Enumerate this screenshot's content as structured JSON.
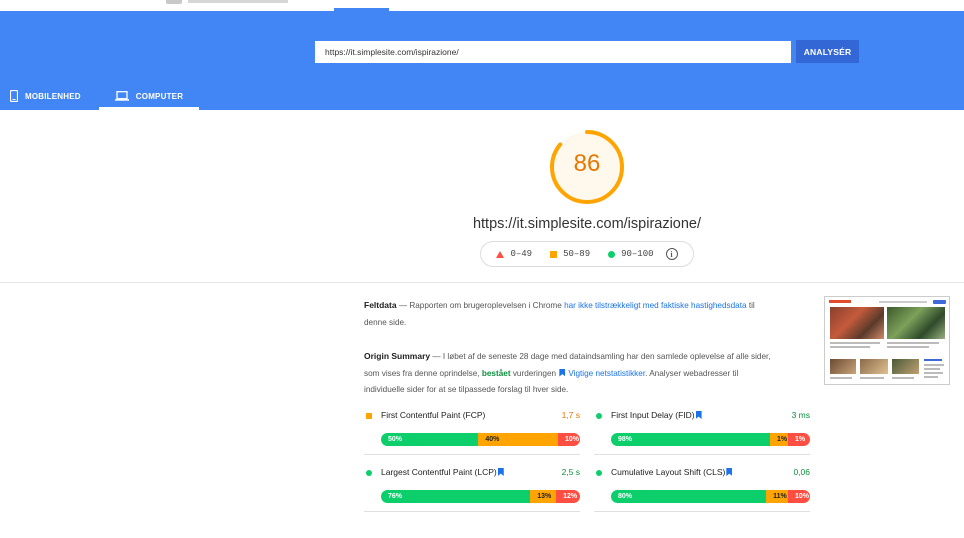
{
  "search": {
    "url_value": "https://it.simplesite.com/ispirazione/",
    "analyze_label": "ANALYSÉR"
  },
  "tabs": [
    {
      "label": "MOBILENHED"
    },
    {
      "label": "COMPUTER"
    }
  ],
  "score": {
    "value": 86,
    "fraction": 0.86,
    "color": "#ffa400"
  },
  "page_url": "https://it.simplesite.com/ispirazione/",
  "legend": {
    "fail": "0–49",
    "average": "50–89",
    "pass": "90–100"
  },
  "field_data": {
    "title": "Feltdata",
    "text_before": " — Rapporten om brugeroplevelsen i Chrome ",
    "link": "har ikke tilstrækkeligt med faktiske hastighedsdata",
    "text_after": " til denne side."
  },
  "origin_summary": {
    "title": "Origin Summary",
    "text1": " — I løbet af de seneste 28 dage med dataindsamling har den samlede oplevelse af alle sider, som vises fra denne oprindelse, ",
    "pass_word": "bestået",
    "text2": " vurderingen ",
    "link": "Vigtige netstatistikker",
    "text3": ". Analyser webadresser til individuelle sider for at se tilpassede forslag til hver side."
  },
  "metrics": [
    {
      "name": "First Contentful Paint (FCP)",
      "value": "1,7 s",
      "fast": "50%",
      "avg": "40%",
      "slow": "10%",
      "fast_n": 50,
      "avg_n": 40,
      "slow_n": 10
    },
    {
      "name": "First Input Delay (FID)",
      "value": "3 ms",
      "fast": "98%",
      "avg": "1%",
      "slow": "1%",
      "fast_n": 98,
      "avg_n": 1,
      "slow_n": 1
    },
    {
      "name": "Largest Contentful Paint (LCP)",
      "value": "2,5 s",
      "fast": "76%",
      "avg": "13%",
      "slow": "12%",
      "fast_n": 76,
      "avg_n": 13,
      "slow_n": 12
    },
    {
      "name": "Cumulative Layout Shift (CLS)",
      "value": "0,06",
      "fast": "80%",
      "avg": "11%",
      "slow": "10%",
      "fast_n": 80,
      "avg_n": 11,
      "slow_n": 10
    }
  ],
  "colors": {
    "header": "#4285f4",
    "fast": "#0cce6b",
    "average": "#ffa400",
    "slow": "#ff4e42",
    "link": "#1a73e8"
  }
}
